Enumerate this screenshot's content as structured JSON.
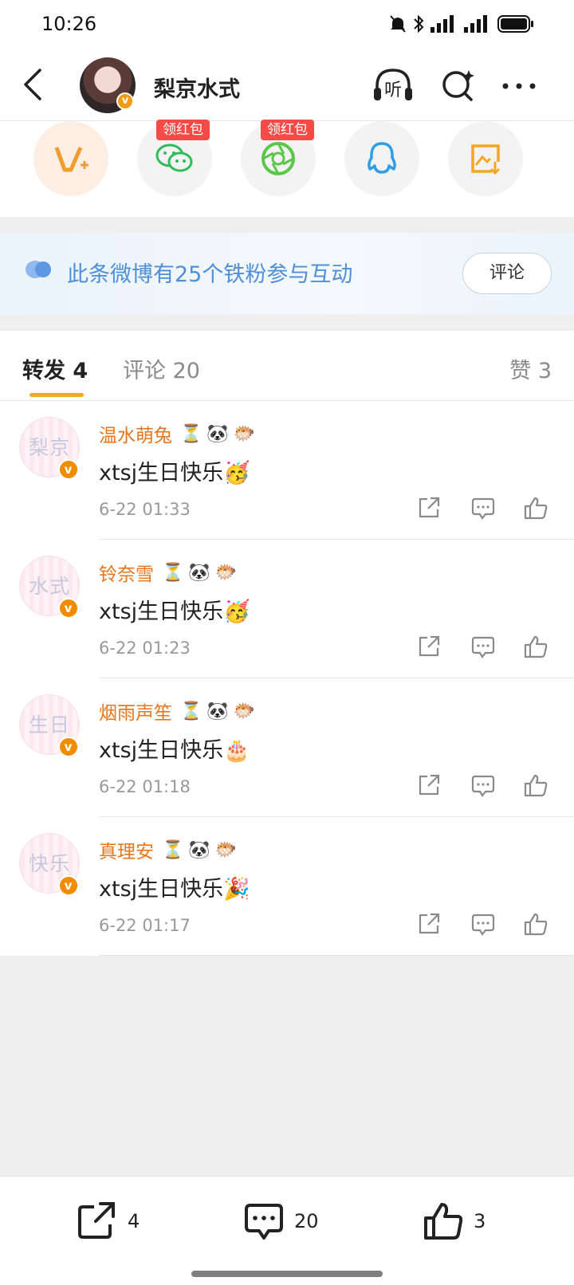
{
  "status_bar": {
    "time": "10:26"
  },
  "header": {
    "title": "梨京水式",
    "listen_label": "听"
  },
  "share_row": {
    "red_tag_1": "领红包",
    "red_tag_2": "领红包"
  },
  "fans_banner": {
    "text": "此条微博有25个铁粉参与互动",
    "button": "评论"
  },
  "tabs": {
    "reposts": "转发 4",
    "comments": "评论 20",
    "likes": "赞 3"
  },
  "reposts": [
    {
      "avatar_text": "梨京",
      "user": "温水萌兔",
      "text": "xtsj生日快乐",
      "emoji": "🥳",
      "time": "6-22 01:33"
    },
    {
      "avatar_text": "水式",
      "user": "铃奈雪",
      "text": "xtsj生日快乐",
      "emoji": "🥳",
      "time": "6-22 01:23"
    },
    {
      "avatar_text": "生日",
      "user": "烟雨声笙",
      "text": "xtsj生日快乐",
      "emoji": "🎂",
      "time": "6-22 01:18"
    },
    {
      "avatar_text": "快乐",
      "user": "真理安",
      "text": "xtsj生日快乐",
      "emoji": "🎉",
      "time": "6-22 01:17"
    }
  ],
  "badge_icons": [
    "hourglass-icon",
    "panda-icon",
    "pufferfish-icon"
  ],
  "bottom_bar": {
    "reposts": "4",
    "comments": "20",
    "likes": "3"
  },
  "colors": {
    "accent": "#f5a623",
    "username": "#e8761d",
    "link_blue": "#4f8fd8",
    "red_tag": "#f54b47"
  }
}
